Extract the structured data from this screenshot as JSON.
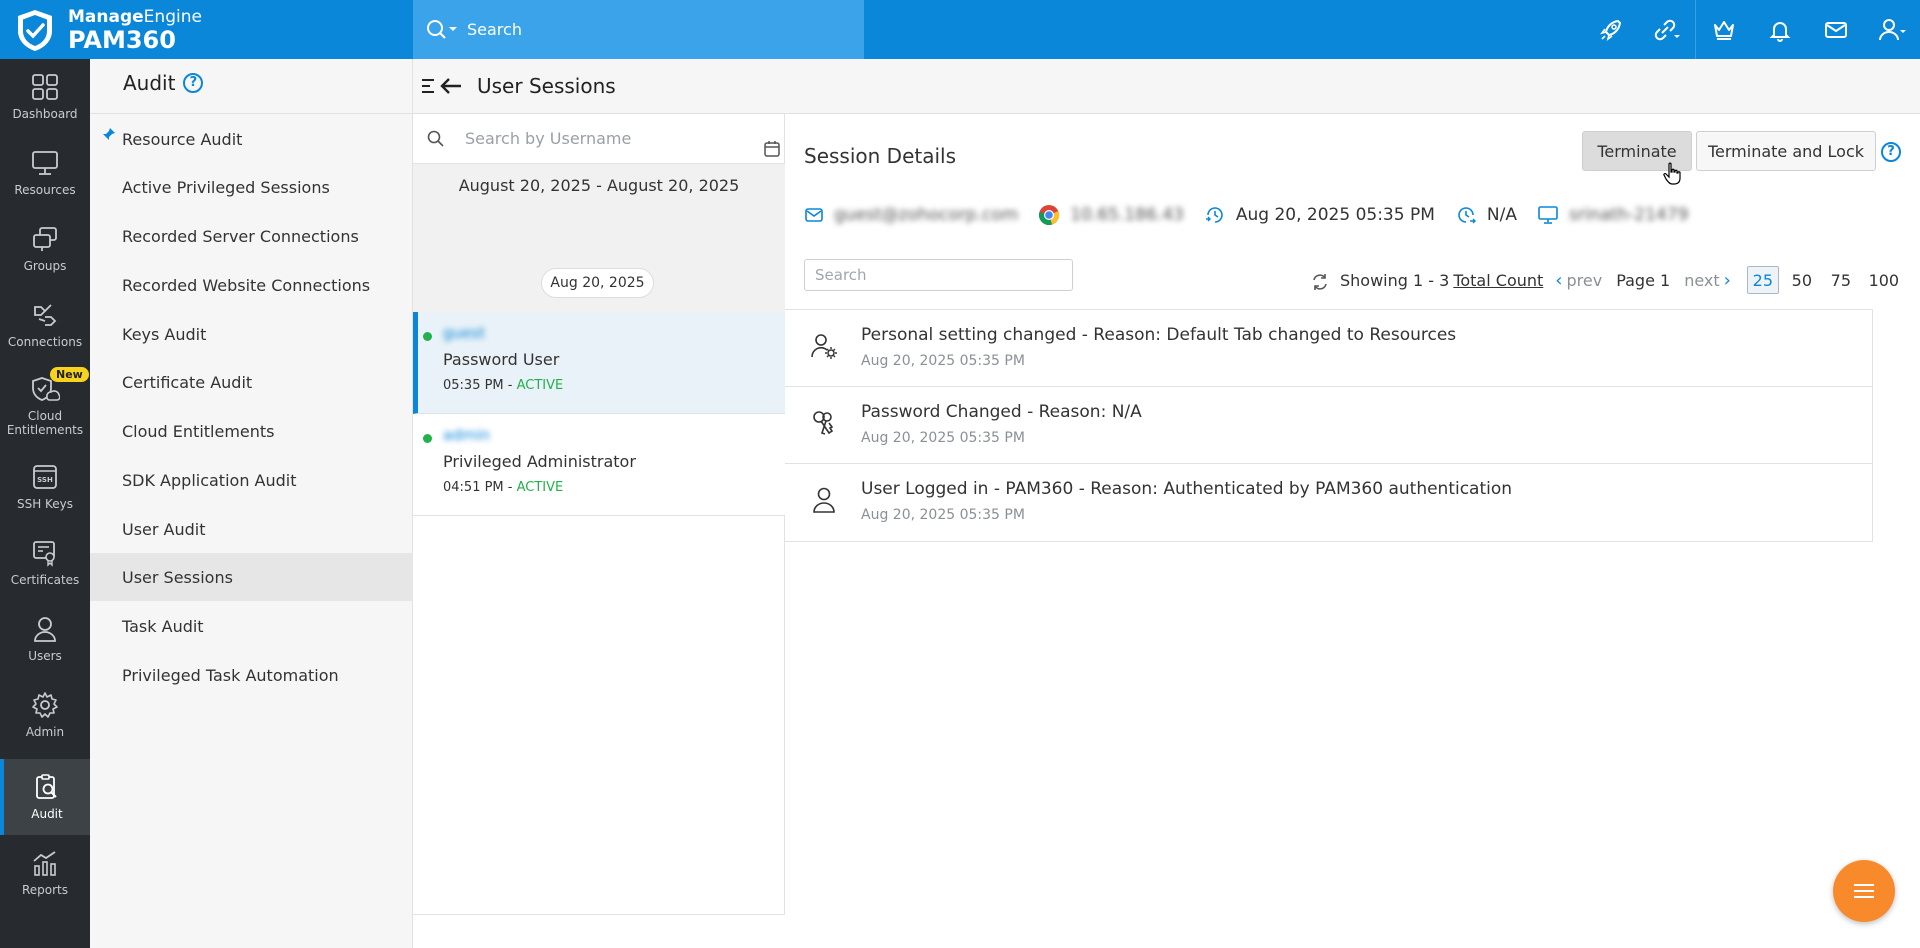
{
  "brand": {
    "line1_bold": "Manage",
    "line1_rest": "Engine",
    "product": "PAM360"
  },
  "search": {
    "placeholder": "Search"
  },
  "topbar_icons": [
    "rocket-icon",
    "link-icon",
    "crown-icon",
    "bell-icon",
    "mail-icon",
    "user-icon"
  ],
  "rail": {
    "items": [
      {
        "label": "Dashboard",
        "icon": "dashboard-icon"
      },
      {
        "label": "Resources",
        "icon": "monitor-icon"
      },
      {
        "label": "Groups",
        "icon": "groups-icon"
      },
      {
        "label": "Connections",
        "icon": "connections-icon"
      },
      {
        "label": "Cloud Entitlements",
        "icon": "cloud-shield-icon",
        "badge": "New"
      },
      {
        "label": "SSH Keys",
        "icon": "ssh-icon"
      },
      {
        "label": "Certificates",
        "icon": "certificate-icon"
      },
      {
        "label": "Users",
        "icon": "users-icon"
      },
      {
        "label": "Admin",
        "icon": "gear-icon"
      },
      {
        "label": "Audit",
        "icon": "audit-icon",
        "active": true
      },
      {
        "label": "Reports",
        "icon": "reports-icon"
      }
    ]
  },
  "audit_menu": {
    "title": "Audit",
    "help": "?",
    "items": [
      {
        "label": "Resource Audit",
        "pinned": true
      },
      {
        "label": "Active Privileged Sessions"
      },
      {
        "label": "Recorded Server Connections"
      },
      {
        "label": "Recorded Website Connections"
      },
      {
        "label": "Keys Audit"
      },
      {
        "label": "Certificate Audit"
      },
      {
        "label": "Cloud Entitlements"
      },
      {
        "label": "SDK Application Audit"
      },
      {
        "label": "User Audit"
      },
      {
        "label": "User Sessions",
        "active": true
      },
      {
        "label": "Task Audit"
      },
      {
        "label": "Privileged Task Automation"
      }
    ]
  },
  "page": {
    "title": "User Sessions"
  },
  "sessions": {
    "search_placeholder": "Search by Username",
    "date_range": "August 20, 2025 - August 20, 2025",
    "date_group": "Aug 20, 2025",
    "list": [
      {
        "username": "guest",
        "role": "Password User",
        "time": "05:35 PM - ",
        "status": "ACTIVE",
        "selected": true
      },
      {
        "username": "admin",
        "role": "Privileged Administrator",
        "time": "04:51 PM - ",
        "status": "ACTIVE",
        "selected": false
      }
    ]
  },
  "details": {
    "title": "Session Details",
    "terminate_label": "Terminate",
    "terminate_lock_label": "Terminate and Lock",
    "help": "?",
    "info": {
      "email": "guest@zohocorp.com",
      "ip": "10.65.186.43",
      "login_time": "Aug 20, 2025 05:35 PM",
      "logout_time": "N/A",
      "host": "srinath-21479"
    },
    "search_placeholder": "Search",
    "pager": {
      "showing": "Showing 1 - 3",
      "total_count": "Total Count",
      "prev": "prev",
      "page": "Page 1",
      "next": "next",
      "sizes": [
        "25",
        "50",
        "75",
        "100"
      ],
      "selected_size": "25"
    },
    "events": [
      {
        "title": "Personal setting changed - Reason: Default Tab changed to Resources",
        "time": "Aug 20, 2025 05:35 PM",
        "icon": "user-settings-icon"
      },
      {
        "title": "Password Changed - Reason: N/A",
        "time": "Aug 20, 2025 05:35 PM",
        "icon": "keys-icon"
      },
      {
        "title": "User Logged in - PAM360 - Reason: Authenticated by PAM360 authentication",
        "time": "Aug 20, 2025 05:35 PM",
        "icon": "user-icon"
      }
    ]
  },
  "colors": {
    "brand_blue": "#0a87d8",
    "rail_bg": "#272b2f",
    "active_green": "#22b14c",
    "fab_orange": "#f98a2c"
  }
}
